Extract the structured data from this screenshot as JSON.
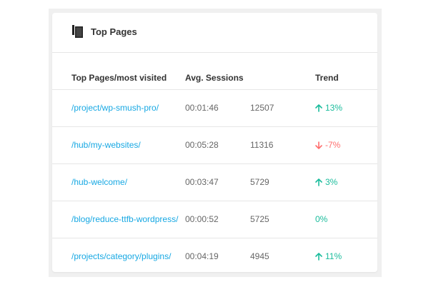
{
  "widget": {
    "title": "Top Pages",
    "icon": "document-stack-icon"
  },
  "table": {
    "headers": {
      "page": "Top Pages/most visited",
      "sessions": "Avg. Sessions",
      "views": "",
      "trend": "Trend"
    },
    "rows": [
      {
        "page": "/project/wp-smush-pro/",
        "time": "00:01:46",
        "count": "12507",
        "trend": "13%",
        "direction": "up"
      },
      {
        "page": "/hub/my-websites/",
        "time": "00:05:28",
        "count": "11316",
        "trend": "-7%",
        "direction": "down"
      },
      {
        "page": "/hub-welcome/",
        "time": "00:03:47",
        "count": "5729",
        "trend": "3%",
        "direction": "up"
      },
      {
        "page": "/blog/reduce-ttfb-wordpress/",
        "time": "00:00:52",
        "count": "5725",
        "trend": "0%",
        "direction": "flat"
      },
      {
        "page": "/projects/category/plugins/",
        "time": "00:04:19",
        "count": "4945",
        "trend": "11%",
        "direction": "up"
      }
    ]
  },
  "colors": {
    "link": "#17a8e3",
    "trend_up": "#1abc9c",
    "trend_down": "#ff6d6d",
    "background": "#f0f0f0"
  }
}
